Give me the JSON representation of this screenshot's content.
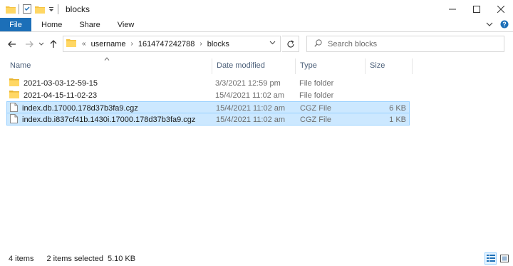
{
  "window": {
    "title": "blocks",
    "controls": {
      "minimize": "—",
      "maximize": "☐",
      "close": "✕"
    }
  },
  "ribbon": {
    "tabs": [
      {
        "label": "File",
        "active": true
      },
      {
        "label": "Home"
      },
      {
        "label": "Share"
      },
      {
        "label": "View"
      }
    ]
  },
  "navigation": {
    "path": [
      "username",
      "1614747242788",
      "blocks"
    ],
    "overflow_marker": "«"
  },
  "search": {
    "placeholder": "Search blocks"
  },
  "columns": {
    "name": "Name",
    "date_modified": "Date modified",
    "type": "Type",
    "size": "Size"
  },
  "files": [
    {
      "name": "2021-03-03-12-59-15",
      "date": "3/3/2021 12:59 pm",
      "type": "File folder",
      "size": "",
      "kind": "folder",
      "selected": false
    },
    {
      "name": "2021-04-15-11-02-23",
      "date": "15/4/2021 11:02 am",
      "type": "File folder",
      "size": "",
      "kind": "folder",
      "selected": false
    },
    {
      "name": "index.db.17000.178d37b3fa9.cgz",
      "date": "15/4/2021 11:02 am",
      "type": "CGZ File",
      "size": "6 KB",
      "kind": "file",
      "selected": true
    },
    {
      "name": "index.db.i837cf41b.1430i.17000.178d37b3fa9.cgz",
      "date": "15/4/2021 11:02 am",
      "type": "CGZ File",
      "size": "1 KB",
      "kind": "file",
      "selected": true
    }
  ],
  "status": {
    "item_count": "4 items",
    "selection": "2 items selected",
    "selection_size": "5.10 KB"
  },
  "colors": {
    "file_tab": "#1c6fb8",
    "selection_bg": "#cce8ff",
    "selection_border": "#99d1ff",
    "folder_yellow": "#f5c343"
  }
}
